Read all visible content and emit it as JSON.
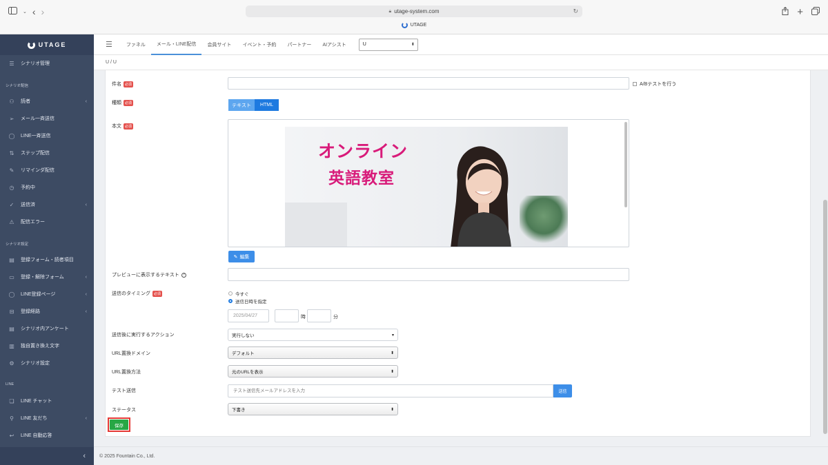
{
  "browser": {
    "url": "utage-system.com",
    "tab_title": "UTAGE"
  },
  "sidebar": {
    "logo": "UTAGE",
    "top_item": {
      "label": "シナリオ管理",
      "icon": "list-icon"
    },
    "section1": "シナリオ配信",
    "items1": [
      {
        "label": "読者",
        "icon": "users-icon",
        "chevron": "‹"
      },
      {
        "label": "メール一斉送信",
        "icon": "send-icon",
        "chevron": ""
      },
      {
        "label": "LINE一斉送信",
        "icon": "chat-icon",
        "chevron": ""
      },
      {
        "label": "ステップ配信",
        "icon": "sort-icon",
        "chevron": ""
      },
      {
        "label": "リマインダ配信",
        "icon": "pencil-icon",
        "chevron": ""
      },
      {
        "label": "予約中",
        "icon": "clock-icon",
        "chevron": ""
      },
      {
        "label": "送信済",
        "icon": "check-icon",
        "chevron": "‹"
      },
      {
        "label": "配信エラー",
        "icon": "warning-icon",
        "chevron": ""
      }
    ],
    "section2": "シナリオ設定",
    "items2": [
      {
        "label": "登録フォーム・読者項目",
        "icon": "table-icon",
        "chevron": ""
      },
      {
        "label": "登録・解除フォーム",
        "icon": "form-icon",
        "chevron": "‹"
      },
      {
        "label": "LINE登録ページ",
        "icon": "chat-icon",
        "chevron": "‹"
      },
      {
        "label": "登録経路",
        "icon": "route-icon",
        "chevron": "‹"
      },
      {
        "label": "シナリオ内アンケート",
        "icon": "table-icon",
        "chevron": ""
      },
      {
        "label": "独自置き換え文字",
        "icon": "doc-icon",
        "chevron": ""
      },
      {
        "label": "シナリオ設定",
        "icon": "gear-icon",
        "chevron": ""
      }
    ],
    "section3": "LINE",
    "items3": [
      {
        "label": "LINE チャット",
        "icon": "chat-bubbles-icon",
        "chevron": ""
      },
      {
        "label": "LINE 友だち",
        "icon": "user-icon",
        "chevron": "‹"
      },
      {
        "label": "LINE 自動応答",
        "icon": "reply-icon",
        "chevron": ""
      }
    ],
    "collapse": "‹"
  },
  "topnav": {
    "tabs": [
      "ファネル",
      "メール・LINE配信",
      "会員サイト",
      "イベント・予約",
      "パートナー",
      "AIアシスト"
    ],
    "active_index": 1,
    "select_value": "U"
  },
  "breadcrumb": "U / U",
  "form": {
    "subject_label": "件名",
    "required": "必須",
    "ab_test_label": "A/Bテストを行う",
    "type_label": "種類",
    "type_text": "テキスト",
    "type_html": "HTML",
    "body_label": "本文",
    "banner_line1": "オンライン",
    "banner_line2": "英語教室",
    "edit_button": "編集",
    "preview_label": "プレビューに表示するテキスト",
    "help_icon": "?",
    "timing_label": "送信のタイミング",
    "timing_now": "今すぐ",
    "timing_scheduled": "送信日時を指定",
    "date_value": "2025/04/27",
    "hour_unit": "時",
    "minute_unit": "分",
    "action_label": "送信後に実行するアクション",
    "action_value": "実行しない",
    "domain_label": "URL置換ドメイン",
    "domain_value": "デフォルト",
    "method_label": "URL置換方法",
    "method_value": "元のURLを表示",
    "test_label": "テスト送信",
    "test_placeholder": "テスト送信先メールアドレスを入力",
    "test_button": "送信",
    "status_label": "ステータス",
    "status_value": "下書き",
    "save_button": "保存"
  },
  "footer": "© 2025 Fountain Co., Ltd.",
  "colors": {
    "sidebar_bg": "#3d4b63",
    "primary": "#3d8ee8",
    "required": "#e4504c",
    "save": "#28a745",
    "highlight": "#e53935",
    "banner_text": "#d81b7a"
  }
}
